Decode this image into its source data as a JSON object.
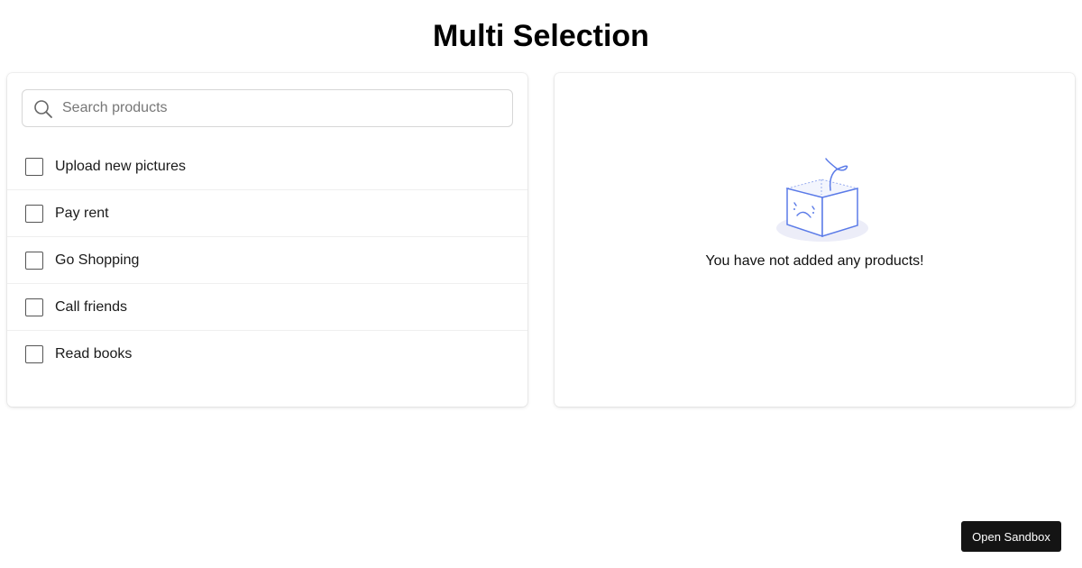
{
  "page": {
    "title": "Multi Selection"
  },
  "search": {
    "placeholder": "Search products",
    "value": ""
  },
  "list": {
    "items": [
      {
        "label": "Upload new pictures",
        "checked": false
      },
      {
        "label": "Pay rent",
        "checked": false
      },
      {
        "label": "Go Shopping",
        "checked": false
      },
      {
        "label": "Call friends",
        "checked": false
      },
      {
        "label": "Read books",
        "checked": false
      }
    ]
  },
  "empty_state": {
    "message": "You have not added any products!",
    "illustration": "empty-box-icon",
    "accent_color": "#5b7be8"
  },
  "footer": {
    "sandbox_label": "Open Sandbox"
  }
}
